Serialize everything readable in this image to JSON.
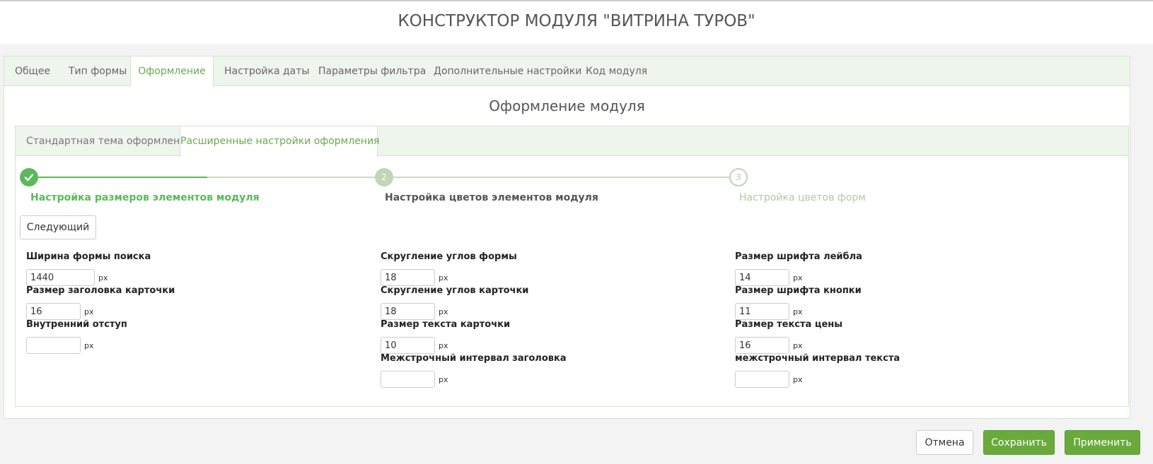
{
  "header": {
    "title": "КОНСТРУКТОР МОДУЛЯ \"ВИТРИНА ТУРОВ\""
  },
  "tabs": [
    {
      "label": "Общее"
    },
    {
      "label": "Тип формы"
    },
    {
      "label": "Оформление"
    },
    {
      "label": "Настройка даты"
    },
    {
      "label": "Параметры фильтра"
    },
    {
      "label": "Дополнительные настройки"
    },
    {
      "label": "Код модуля"
    }
  ],
  "active_tab": "Оформление",
  "section": {
    "title": "Оформление модуля"
  },
  "subtabs": [
    {
      "label": "Стандартная тема оформления"
    },
    {
      "label": "Расширенные настройки оформления"
    }
  ],
  "active_subtab": "Расширенные настройки оформления",
  "steps": [
    {
      "number": "✓",
      "label": "Настройка размеров элементов модуля",
      "state": "completed"
    },
    {
      "number": "2",
      "label": "Настройка цветов элементов модуля",
      "state": "current"
    },
    {
      "number": "3",
      "label": "Настройка цветов форм",
      "state": "upcoming"
    }
  ],
  "step_progress_fraction": 0.5,
  "next_button": "Следующий",
  "unit": "px",
  "fields": {
    "search_form_width": {
      "label": "Ширина формы поиска",
      "value": "1440"
    },
    "card_title_size": {
      "label": "Размер заголовка карточки",
      "value": "16"
    },
    "inner_padding": {
      "label": "Внутренний отступ",
      "value": ""
    },
    "form_radius": {
      "label": "Скругление углов формы",
      "value": "18"
    },
    "card_radius": {
      "label": "Скругление углов карточки",
      "value": "18"
    },
    "card_text_size": {
      "label": "Размер текста карточки",
      "value": "10"
    },
    "title_line_height": {
      "label": "Межстрочный интервал заголовка",
      "value": ""
    },
    "label_font_size": {
      "label": "Размер шрифта лейбла",
      "value": "14"
    },
    "button_font_size": {
      "label": "Размер шрифта кнопки",
      "value": "11"
    },
    "price_text_size": {
      "label": "Размер текста цены",
      "value": "16"
    },
    "text_line_height": {
      "label": "межстрочный интервал текста",
      "value": ""
    }
  },
  "footer": {
    "cancel": "Отмена",
    "save": "Сохранить",
    "apply": "Применить"
  },
  "colors": {
    "accent": "#6aaa3d",
    "step_done": "#5cb85c",
    "tab_bg": "#eef5ec"
  }
}
